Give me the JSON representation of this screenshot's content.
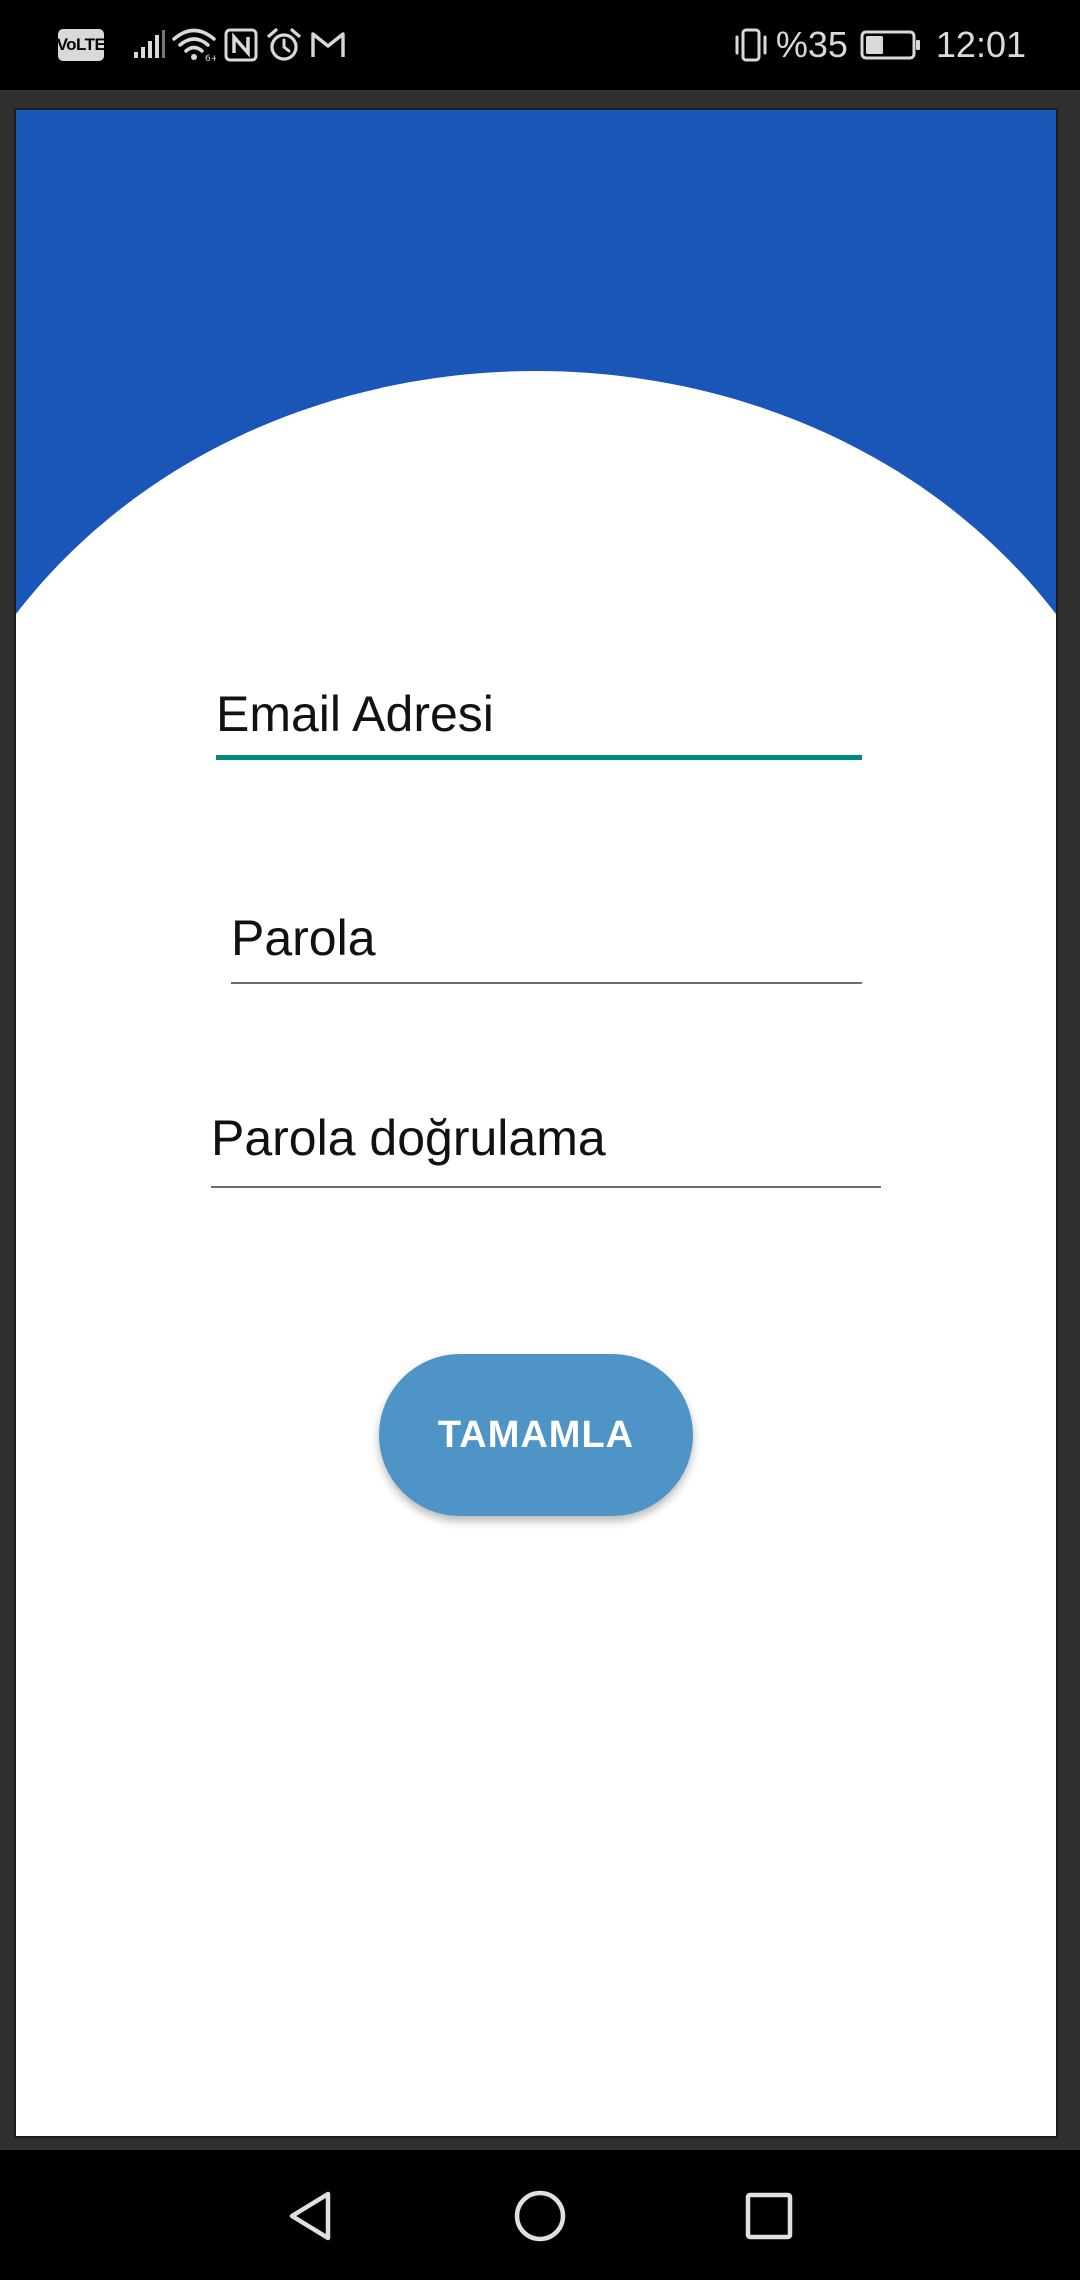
{
  "status_bar": {
    "network_badge": "VoLTE",
    "battery_percent": "%35",
    "time": "12:01",
    "icons": [
      "volte-icon",
      "signal-icon",
      "wifi-icon",
      "nfc-icon",
      "alarm-icon",
      "gmail-icon",
      "vibrate-icon",
      "battery-icon"
    ]
  },
  "colors": {
    "header_blue": "#1a56b8",
    "focused_underline": "#00897b",
    "button": "#4f94c6"
  },
  "form": {
    "email_label": "Email Adresi",
    "password_label": "Parola",
    "password_confirm_label": "Parola doğrulama",
    "submit_label": "TAMAMLA"
  },
  "nav_bar": {
    "icons": [
      "back-icon",
      "home-icon",
      "recents-icon"
    ]
  }
}
